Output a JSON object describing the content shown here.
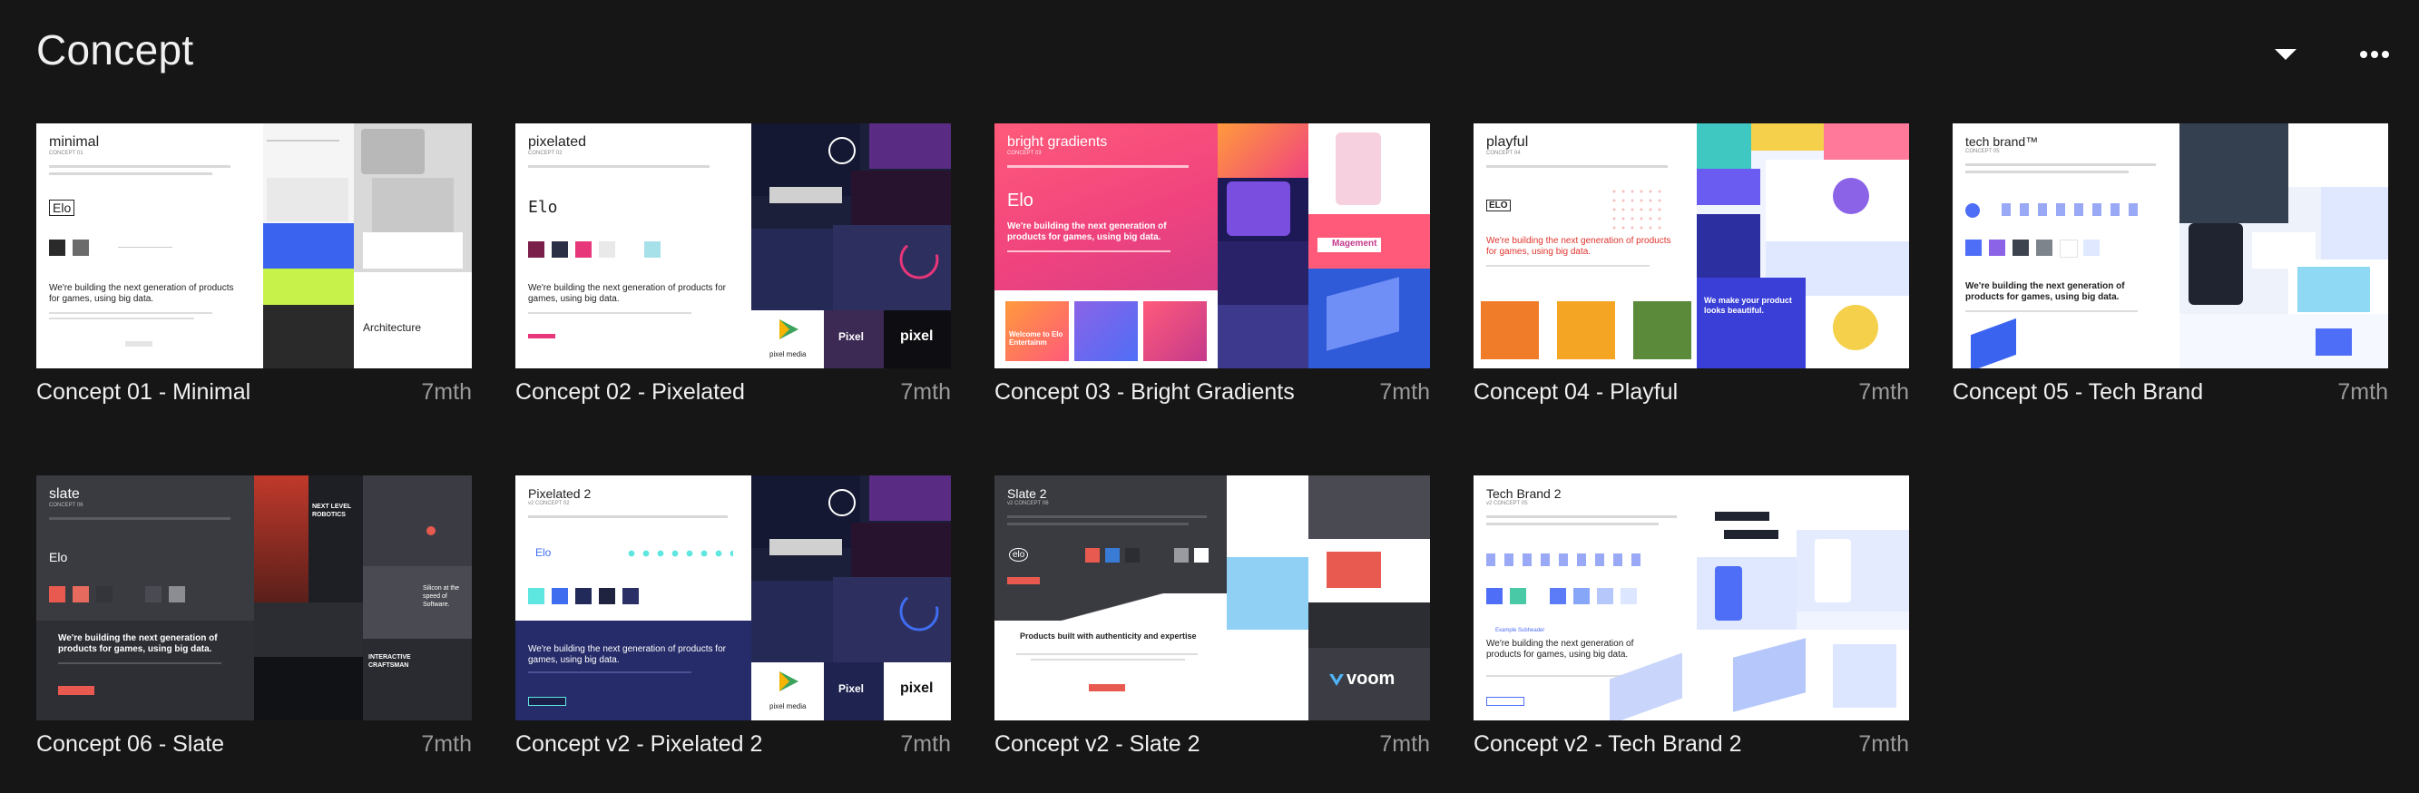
{
  "header": {
    "title": "Concept",
    "icons": {
      "dropdown": "chevron-down-icon",
      "more": "more-dots-icon"
    }
  },
  "concepts": [
    {
      "name": "Concept 01 - Minimal",
      "date": "7mth",
      "thumb": {
        "heading": "minimal",
        "label": "CONCEPT 01",
        "logo": "Elo",
        "tagline": "We're building the next generation of products for games, using big data.",
        "panel_text": "Architecture",
        "swatches": [
          "#2a2a2a",
          "#6b6b6b"
        ]
      }
    },
    {
      "name": "Concept 02 - Pixelated",
      "date": "7mth",
      "thumb": {
        "heading": "pixelated",
        "label": "CONCEPT 02",
        "logo": "Elo",
        "tagline": "We're building the next generation of products for games, using big data.",
        "brand1": "pixel media",
        "brand2": "Pixel",
        "brand3": "pixel",
        "swatches": [
          "#7a1f4a",
          "#2b2f45",
          "#e8367a",
          "#e9e9e9",
          "#a6e1ea"
        ]
      }
    },
    {
      "name": "Concept 03 - Bright Gradients",
      "date": "7mth",
      "thumb": {
        "heading": "bright gradients",
        "label": "CONCEPT 03",
        "logo": "Elo",
        "tagline": "We're building the next generation of products for games, using big data.",
        "card_text": "Welcome to Elo Entertainm",
        "brand": "Magement"
      }
    },
    {
      "name": "Concept 04 - Playful",
      "date": "7mth",
      "thumb": {
        "heading": "playful",
        "label": "CONCEPT 04",
        "logo": "ELO",
        "tagline": "We're building the next generation of products for games, using big data.",
        "cta": "We make your product looks beautiful."
      }
    },
    {
      "name": "Concept 05 - Tech Brand",
      "date": "7mth",
      "thumb": {
        "heading": "tech brand™",
        "label": "CONCEPT 05",
        "tagline": "We're building the next generation of products for games, using big data.",
        "swatches": [
          "#4f6ef7",
          "#8a63e6",
          "#3d4450",
          "#7d848c",
          "#ffffff",
          "#dfe8ff"
        ]
      }
    },
    {
      "name": "Concept 06 - Slate",
      "date": "7mth",
      "thumb": {
        "heading": "slate",
        "label": "CONCEPT 06",
        "logo": "Elo",
        "tagline": "We're building the next generation of products for games, using big data.",
        "panel1": "NEXT LEVEL ROBOTICS",
        "panel2": "Silicon at the speed of Software.",
        "panel3": "INTERACTIVE CRAFTSMAN",
        "swatches": [
          "#e85a4f",
          "#e66a5d",
          "#34353b",
          "#4a4b52",
          "#8c8d93"
        ]
      }
    },
    {
      "name": "Concept v2 - Pixelated 2",
      "date": "7mth",
      "thumb": {
        "heading": "Pixelated 2",
        "label": "v2 CONCEPT 02",
        "logo": "Elo",
        "tagline": "We're building the next generation of products for games, using big data.",
        "brand1": "pixel media",
        "brand2": "Pixel",
        "brand3": "pixel",
        "swatches": [
          "#5ee6e0",
          "#3f6df0",
          "#222a5a",
          "#1f2340",
          "#2a2f66"
        ]
      }
    },
    {
      "name": "Concept v2 - Slate 2",
      "date": "7mth",
      "thumb": {
        "heading": "Slate 2",
        "label": "v2 CONCEPT 06",
        "logo": "elo",
        "tagline": "Products built with authenticity and expertise",
        "brand": "voom",
        "swatches": [
          "#e85a4f",
          "#3a7bd5",
          "#2c2d33",
          "#9a9ba0",
          "#ffffff"
        ]
      }
    },
    {
      "name": "Concept v2 - Tech Brand 2",
      "date": "7mth",
      "thumb": {
        "heading": "Tech Brand 2",
        "label": "v2 CONCEPT 05",
        "tagline": "We're building the next generation of products for games, using big data.",
        "subhead": "Example Subheader",
        "swatches": [
          "#4f6ef7",
          "#49c9a5",
          "#5b7cf6",
          "#88a6f8",
          "#b6c8fb",
          "#dce6ff"
        ]
      }
    }
  ]
}
